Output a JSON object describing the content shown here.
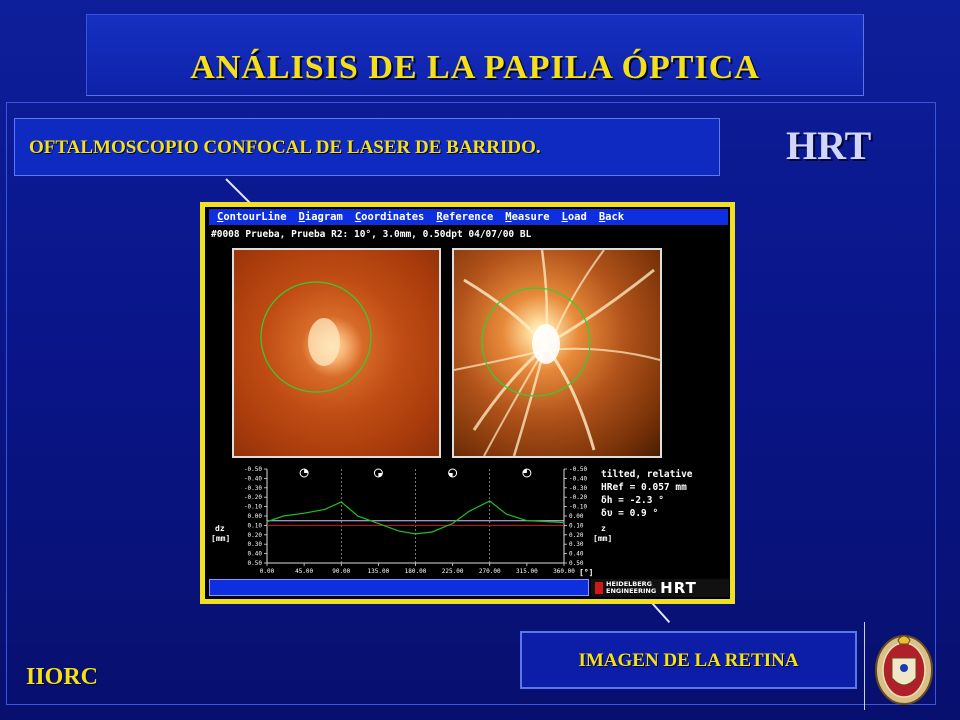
{
  "slide": {
    "title": "ANÁLISIS DE LA PAPILA ÓPTICA",
    "subtitle": "OFTALMOSCOPIO CONFOCAL DE LASER DE BARRIDO.",
    "device_label": "HRT",
    "caption": "IMAGEN DE LA RETINA",
    "organization": "IIORC"
  },
  "software": {
    "menu": [
      {
        "key": "C",
        "rest": "ontourLine"
      },
      {
        "key": "D",
        "rest": "iagram"
      },
      {
        "key": "C",
        "rest": "oordinates"
      },
      {
        "key": "R",
        "rest": "eference"
      },
      {
        "key": "M",
        "rest": "easure"
      },
      {
        "key": "L",
        "rest": "oad"
      },
      {
        "key": "B",
        "rest": "ack"
      }
    ],
    "info_line": "#0008 Prueba, Prueba  R2: 10°, 3.0mm, 0.50dpt 04/07/00 BL",
    "stats": [
      "tilted, relative",
      "HRef = 0.057 mm",
      "δh   =   -2.3 °",
      "δυ   =    0.9 °"
    ],
    "left_axis_label": "dz",
    "left_axis_unit": "[mm]",
    "right_axis_label": "z",
    "right_axis_unit": "[mm]",
    "x_axis_unit": "[°]",
    "logo_line1": "HEIDELBERG",
    "logo_line2": "ENGINEERING",
    "logo_mark": "HRT"
  },
  "chart_data": {
    "type": "line",
    "x_ticks": [
      "0.00",
      "45.00",
      "90.00",
      "135.00",
      "180.00",
      "225.00",
      "270.00",
      "315.00",
      "360.00"
    ],
    "y_ticks_left": [
      "-0.50",
      "-0.40",
      "-0.30",
      "-0.20",
      "-0.10",
      "0.00",
      "0.10",
      "0.20",
      "0.30",
      "0.40",
      "0.50"
    ],
    "y_ticks_right": [
      "-0.50",
      "-0.40",
      "-0.30",
      "-0.20",
      "-0.10",
      "0.00",
      "0.10",
      "0.20",
      "0.30",
      "0.40",
      "0.50"
    ],
    "xlim": [
      0,
      360
    ],
    "ylim": [
      -0.5,
      0.5
    ],
    "y_inverted": true,
    "reference_lines": [
      {
        "color": "#d01818",
        "y": 0.1
      },
      {
        "color": "#c8c8ff",
        "y": 0.05
      }
    ],
    "series": [
      {
        "color": "#22c022",
        "x": [
          0,
          20,
          45,
          70,
          90,
          110,
          135,
          160,
          180,
          200,
          225,
          245,
          270,
          290,
          315,
          340,
          360
        ],
        "y": [
          0.06,
          0.0,
          -0.03,
          -0.07,
          -0.15,
          0.0,
          0.08,
          0.16,
          0.19,
          0.17,
          0.08,
          -0.05,
          -0.16,
          -0.02,
          0.05,
          0.06,
          0.07
        ]
      }
    ],
    "sector_icons": 4
  },
  "colors": {
    "accent_yellow": "#f4e01a",
    "background_blue": "#0a158a",
    "menu_blue": "#0e2fe0"
  }
}
